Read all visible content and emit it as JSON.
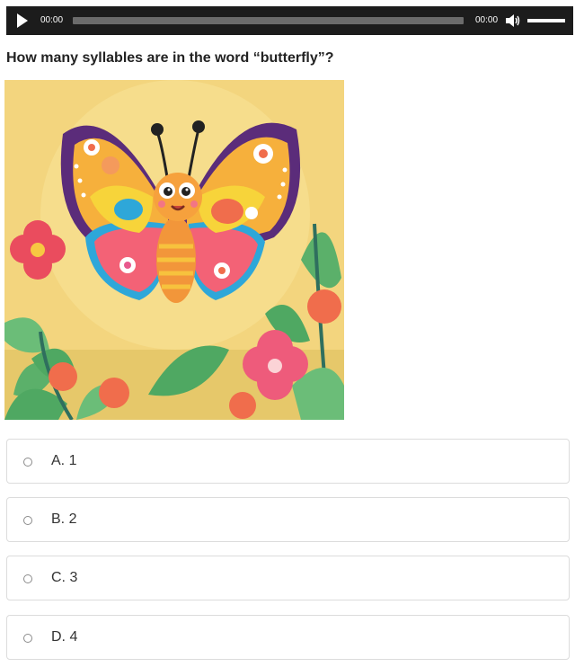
{
  "player": {
    "current_time": "00:00",
    "total_time": "00:00",
    "progress": 0,
    "volume": 1,
    "play_icon": "play-icon",
    "volume_icon": "speaker-icon"
  },
  "question": {
    "text": "How many syllables are in the word “butterfly”?"
  },
  "image": {
    "subject": "cartoon butterfly with flowers"
  },
  "options": [
    {
      "letter": "A.",
      "label": "A. 1"
    },
    {
      "letter": "B.",
      "label": "B. 2"
    },
    {
      "letter": "C.",
      "label": "C. 3"
    },
    {
      "letter": "D.",
      "label": "D. 4"
    }
  ],
  "colors": {
    "player_bg": "#1c1c1c",
    "option_border": "#dcdcdc"
  }
}
